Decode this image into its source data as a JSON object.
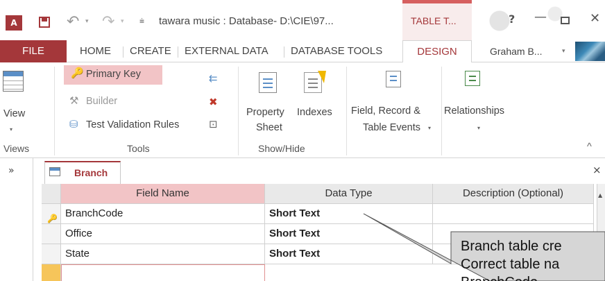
{
  "titlebar": {
    "app_logo": "A",
    "icons": {
      "save": "save-icon",
      "undo": "undo-icon",
      "redo": "redo-icon",
      "customize": "customize-qat-icon"
    },
    "glyphs": {
      "undo": "↶",
      "redo": "↷",
      "caret": "▾",
      "customize": "⩧",
      "help": "?",
      "minimize": "—",
      "close": "✕"
    },
    "title": "tawara music : Database- D:\\CIE\\97...",
    "context_tab": "TABLE T..."
  },
  "tabs": {
    "file": "FILE",
    "items": [
      "HOME",
      "CREATE",
      "EXTERNAL DATA",
      "DATABASE TOOLS"
    ],
    "active": "DESIGN",
    "account": "Graham B...",
    "accent_color": "#a4373a"
  },
  "ribbon": {
    "views": {
      "button": "View",
      "group": "Views"
    },
    "tools": {
      "primary_key": "Primary Key",
      "builder": "Builder",
      "test_rules": "Test Validation Rules",
      "group": "Tools",
      "icon_glyphs": {
        "key": "🔑",
        "builder": "⚒",
        "test": "⛁",
        "insert_rows": "⇇",
        "delete_rows": "✖",
        "modify_lookups": "⊡"
      }
    },
    "show_hide": {
      "property_sheet_1": "Property",
      "property_sheet_2": "Sheet",
      "indexes": "Indexes",
      "group": "Show/Hide"
    },
    "events": {
      "line1": "Field, Record &",
      "line2": "Table Events"
    },
    "relationships": {
      "label": "Relationships"
    },
    "collapse_glyph": "^"
  },
  "nav": {
    "toggle": "»"
  },
  "document": {
    "tab_label": "Branch",
    "close_glyph": "×",
    "columns": [
      "Field Name",
      "Data Type",
      "Description (Optional)"
    ],
    "rows": [
      {
        "field": "BranchCode",
        "type": "Short Text",
        "primary_key": true
      },
      {
        "field": "Office",
        "type": "Short Text",
        "primary_key": false
      },
      {
        "field": "State",
        "type": "Short Text",
        "primary_key": false
      }
    ],
    "key_glyph": "🔑"
  },
  "callout": {
    "line1": "Branch table cre",
    "line2": "Correct table na",
    "line3": "BranchCode"
  }
}
